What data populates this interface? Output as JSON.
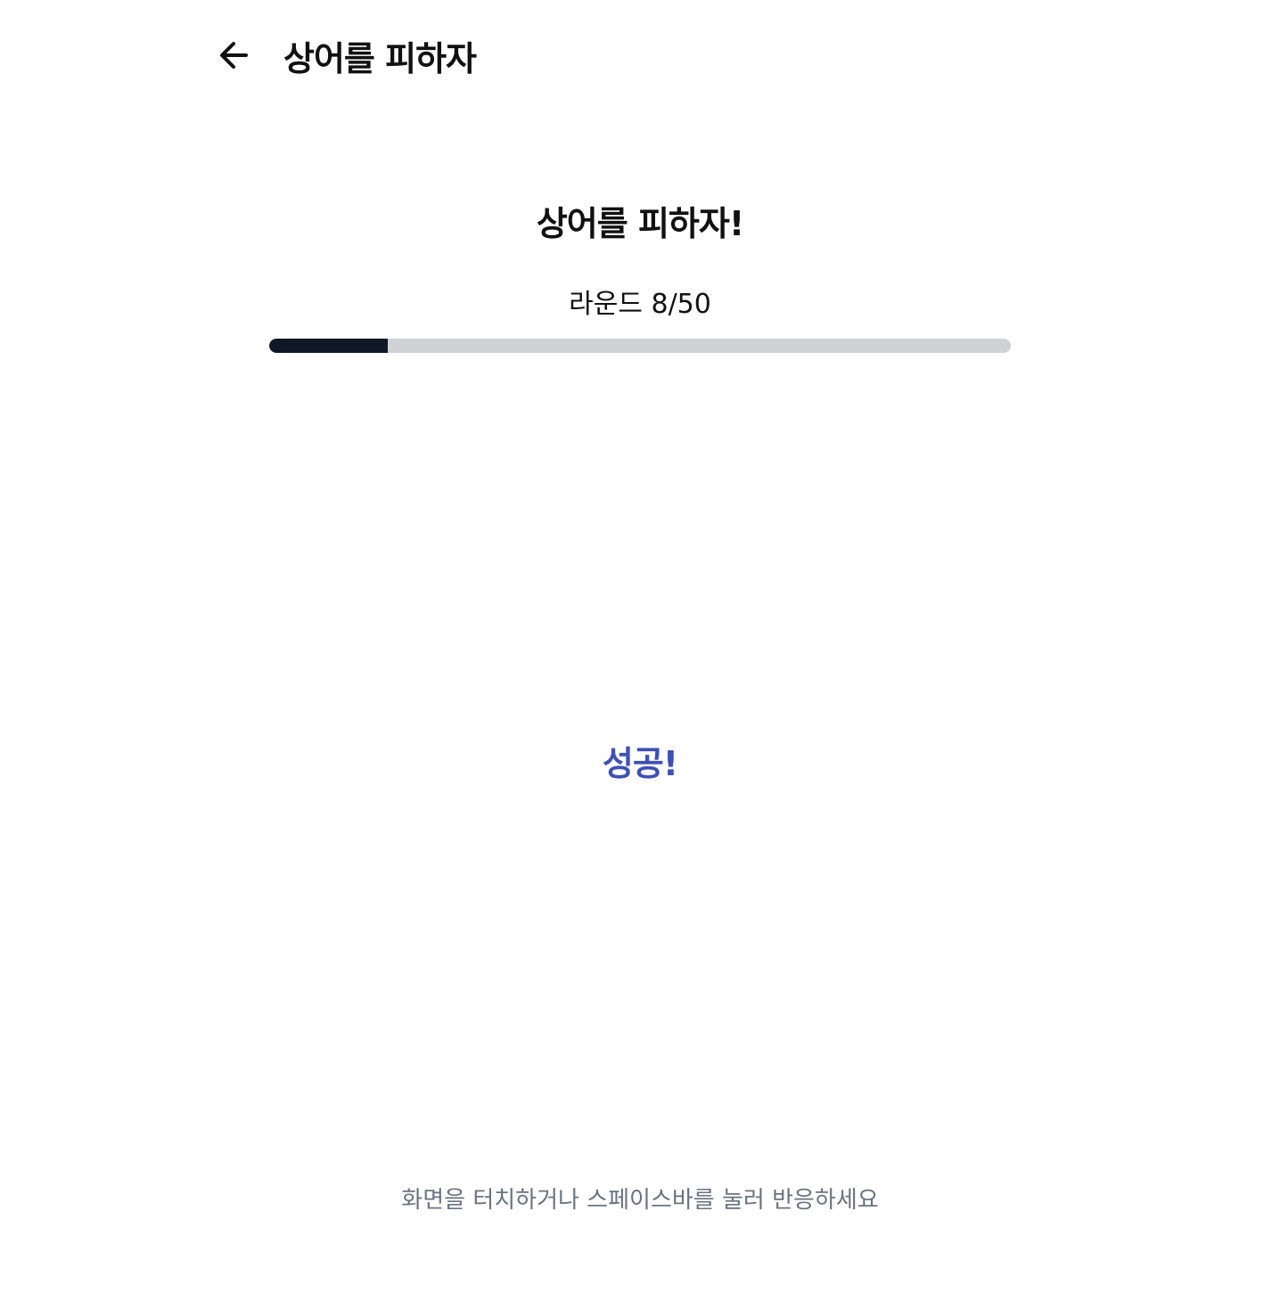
{
  "header": {
    "back_icon": "arrow-left-icon",
    "title": "상어를 피하자"
  },
  "game": {
    "title": "상어를 피하자!",
    "round_label": "라운드",
    "round_current": 8,
    "round_total": 50,
    "round_text": "라운드 8/50",
    "progress_fraction": 0.16,
    "result": "성공!",
    "hint": "화면을 터치하거나 스페이스바를 눌러 반응하세요"
  },
  "colors": {
    "result": "#3f51b5",
    "progress_fill": "#101828",
    "progress_track": "#d1d2d6",
    "hint": "#6b7280"
  }
}
